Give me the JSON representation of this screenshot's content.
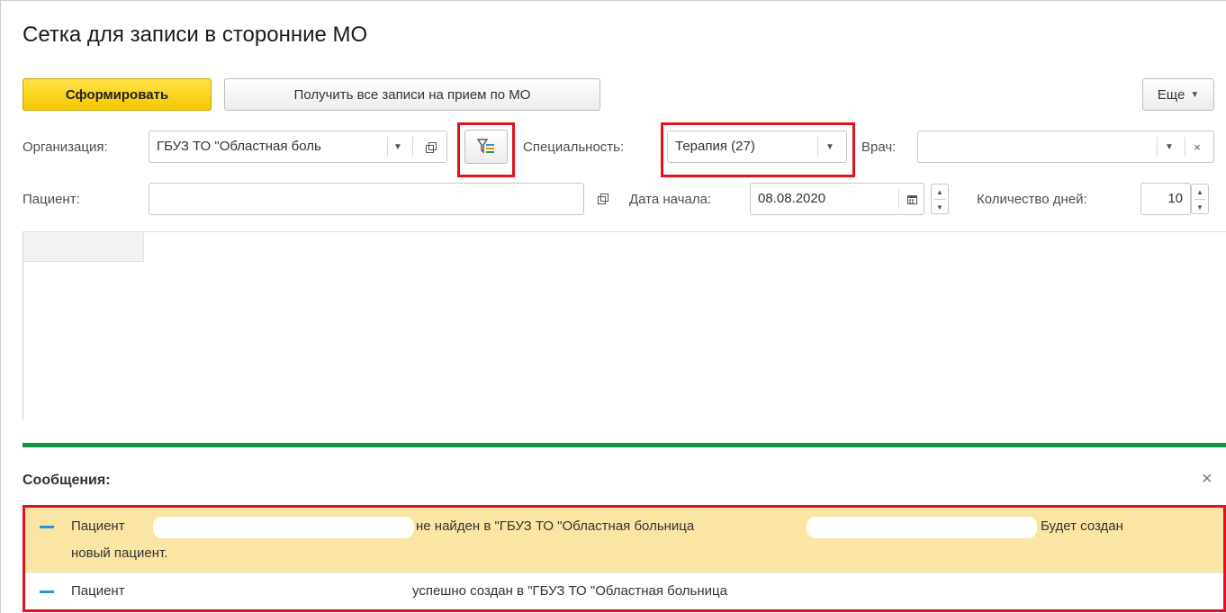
{
  "page": {
    "title": "Сетка для записи в сторонние МО"
  },
  "toolbar": {
    "generate_label": "Сформировать",
    "get_all_label": "Получить все записи на прием по МО",
    "more_label": "Еще"
  },
  "filters": {
    "organization_label": "Организация:",
    "organization_value": "ГБУЗ ТО \"Областная боль",
    "specialty_label": "Специальность:",
    "specialty_value": "Терапия (27)",
    "doctor_label": "Врач:",
    "doctor_value": "",
    "patient_label": "Пациент:",
    "patient_value": "",
    "start_date_label": "Дата начала:",
    "start_date_value": "08.08.2020",
    "days_label": "Количество дней:",
    "days_value": "10"
  },
  "messages": {
    "title": "Сообщения:",
    "items": [
      {
        "part1": "Пациент",
        "part2": "не найден в \"ГБУЗ ТО \"Областная больница",
        "part3": "Будет создан",
        "line2": "новый пациент."
      },
      {
        "part1": "Пациент",
        "part2": "успешно создан в \"ГБУЗ ТО \"Областная больница"
      }
    ]
  },
  "colors": {
    "accent_yellow": "#f4c800",
    "divider_green": "#149444",
    "highlight_red": "#e0121b",
    "warning_bg": "#fbe5a4"
  }
}
